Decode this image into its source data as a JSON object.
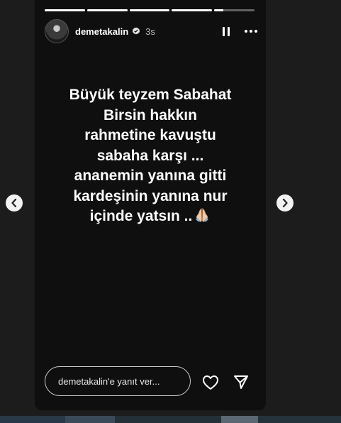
{
  "story": {
    "username": "demetakalin",
    "time_ago": "3s",
    "progress": [
      1,
      1,
      1,
      1,
      0.22
    ],
    "text_lines": [
      "Büyük teyzem Sabahat",
      "Birsin  hakkın",
      "rahmetine kavuştu",
      "sabaha karşı ...",
      "ananemin yanına gitti",
      "kardeşinin yanına nur",
      "içinde yatsın .."
    ],
    "emoji": "folded-hands"
  },
  "reply": {
    "placeholder": "demetakalin'e yanıt ver..."
  },
  "icons": {
    "verified": "verified-badge-icon",
    "pause": "pause-icon",
    "more": "more-options-icon",
    "like": "heart-icon",
    "share": "send-icon",
    "prev": "chevron-left-icon",
    "next": "chevron-right-icon"
  },
  "colors": {
    "background": "#1c1c1c",
    "story_bg": "#0f0f0f",
    "text": "#ffffff"
  }
}
